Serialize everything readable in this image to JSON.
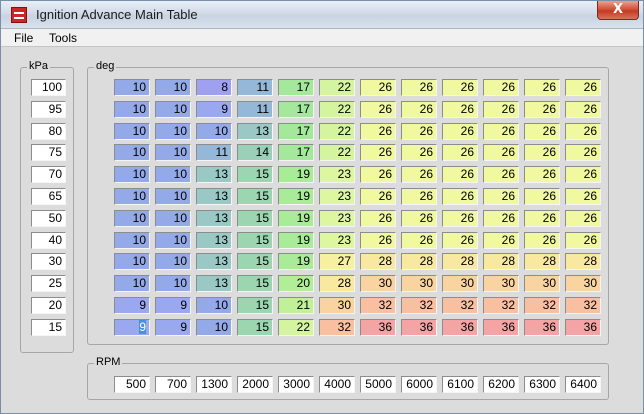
{
  "window": {
    "title": "Ignition Advance Main Table",
    "close_label": "X"
  },
  "menu": [
    "File",
    "Tools"
  ],
  "kpa": {
    "label": "kPa",
    "values": [
      "100",
      "95",
      "80",
      "75",
      "70",
      "65",
      "50",
      "40",
      "30",
      "25",
      "20",
      "15"
    ]
  },
  "deg": {
    "label": "deg",
    "rows": [
      [
        "10",
        "10",
        "8",
        "11",
        "17",
        "22",
        "26",
        "26",
        "26",
        "26",
        "26",
        "26"
      ],
      [
        "10",
        "10",
        "9",
        "11",
        "17",
        "22",
        "26",
        "26",
        "26",
        "26",
        "26",
        "26"
      ],
      [
        "10",
        "10",
        "10",
        "13",
        "17",
        "22",
        "26",
        "26",
        "26",
        "26",
        "26",
        "26"
      ],
      [
        "10",
        "10",
        "11",
        "14",
        "17",
        "22",
        "26",
        "26",
        "26",
        "26",
        "26",
        "26"
      ],
      [
        "10",
        "10",
        "13",
        "15",
        "19",
        "23",
        "26",
        "26",
        "26",
        "26",
        "26",
        "26"
      ],
      [
        "10",
        "10",
        "13",
        "15",
        "19",
        "23",
        "26",
        "26",
        "26",
        "26",
        "26",
        "26"
      ],
      [
        "10",
        "10",
        "13",
        "15",
        "19",
        "23",
        "26",
        "26",
        "26",
        "26",
        "26",
        "26"
      ],
      [
        "10",
        "10",
        "13",
        "15",
        "19",
        "23",
        "26",
        "26",
        "26",
        "26",
        "26",
        "26"
      ],
      [
        "10",
        "10",
        "13",
        "15",
        "19",
        "27",
        "28",
        "28",
        "28",
        "28",
        "28",
        "28"
      ],
      [
        "10",
        "10",
        "13",
        "15",
        "20",
        "28",
        "30",
        "30",
        "30",
        "30",
        "30",
        "30"
      ],
      [
        "9",
        "9",
        "10",
        "15",
        "21",
        "30",
        "32",
        "32",
        "32",
        "32",
        "32",
        "32"
      ],
      [
        "9",
        "9",
        "10",
        "15",
        "22",
        "32",
        "36",
        "36",
        "36",
        "36",
        "36",
        "36"
      ]
    ]
  },
  "rpm": {
    "label": "RPM",
    "values": [
      "500",
      "700",
      "1300",
      "2000",
      "3000",
      "4000",
      "5000",
      "6000",
      "6100",
      "6200",
      "6300",
      "6400"
    ]
  },
  "colors": {
    "8": "#a0a0f0",
    "9": "#9aa8f0",
    "10": "#94aae8",
    "11": "#96b8d8",
    "13": "#9ac8c4",
    "14": "#9acfb8",
    "15": "#9cd6b0",
    "17": "#a4e89c",
    "19": "#a8ec98",
    "20": "#b0ee98",
    "21": "#c0f098",
    "22": "#d4f4a0",
    "23": "#ddf6a0",
    "26": "#f0f8a0",
    "27": "#f6f0a0",
    "28": "#f8e8a0",
    "30": "#fad4a0",
    "32": "#f8c0a0",
    "36": "#f4a4a4",
    "selected": "#4a8fe0"
  }
}
